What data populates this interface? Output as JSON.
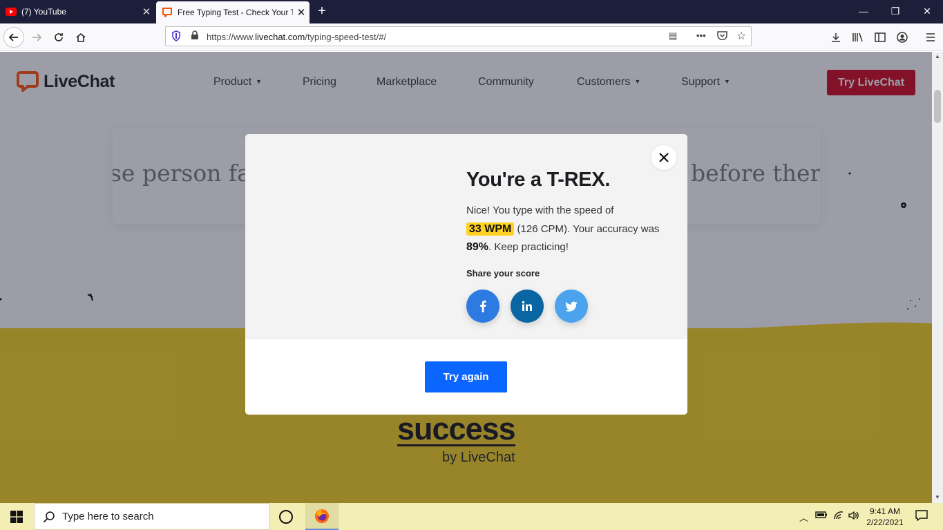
{
  "browser": {
    "tabs": [
      {
        "title": "(7) YouTube",
        "active": false
      },
      {
        "title": "Free Typing Test - Check Your T",
        "active": true
      }
    ],
    "url_prefix": "https://www.",
    "url_domain": "livechat.com",
    "url_path": "/typing-speed-test/#/"
  },
  "site": {
    "logo_text": "LiveChat",
    "nav": [
      {
        "label": "Product",
        "dropdown": true
      },
      {
        "label": "Pricing",
        "dropdown": false
      },
      {
        "label": "Marketplace",
        "dropdown": false
      },
      {
        "label": "Community",
        "dropdown": false
      },
      {
        "label": "Customers",
        "dropdown": true
      },
      {
        "label": "Support",
        "dropdown": true
      }
    ],
    "cta_label": "Try LiveChat",
    "brand_color": "#d0021b"
  },
  "typing_test": {
    "text_left": "se person fal",
    "text_right": "before there"
  },
  "modal": {
    "title": "You're a T-REX.",
    "desc_intro": "Nice! You type with the speed of",
    "wpm": "33 WPM",
    "cpm_text": "(126 CPM). Your accuracy was",
    "accuracy": "89%",
    "desc_outro": ". Keep practicing!",
    "share_label": "Share your score",
    "social": [
      "facebook",
      "linkedin",
      "twitter"
    ],
    "try_again_label": "Try again"
  },
  "footer_brand": {
    "word": "success",
    "by": "by LiveChat"
  },
  "taskbar": {
    "search_placeholder": "Type here to search",
    "time": "9:41 AM",
    "date": "2/22/2021"
  }
}
